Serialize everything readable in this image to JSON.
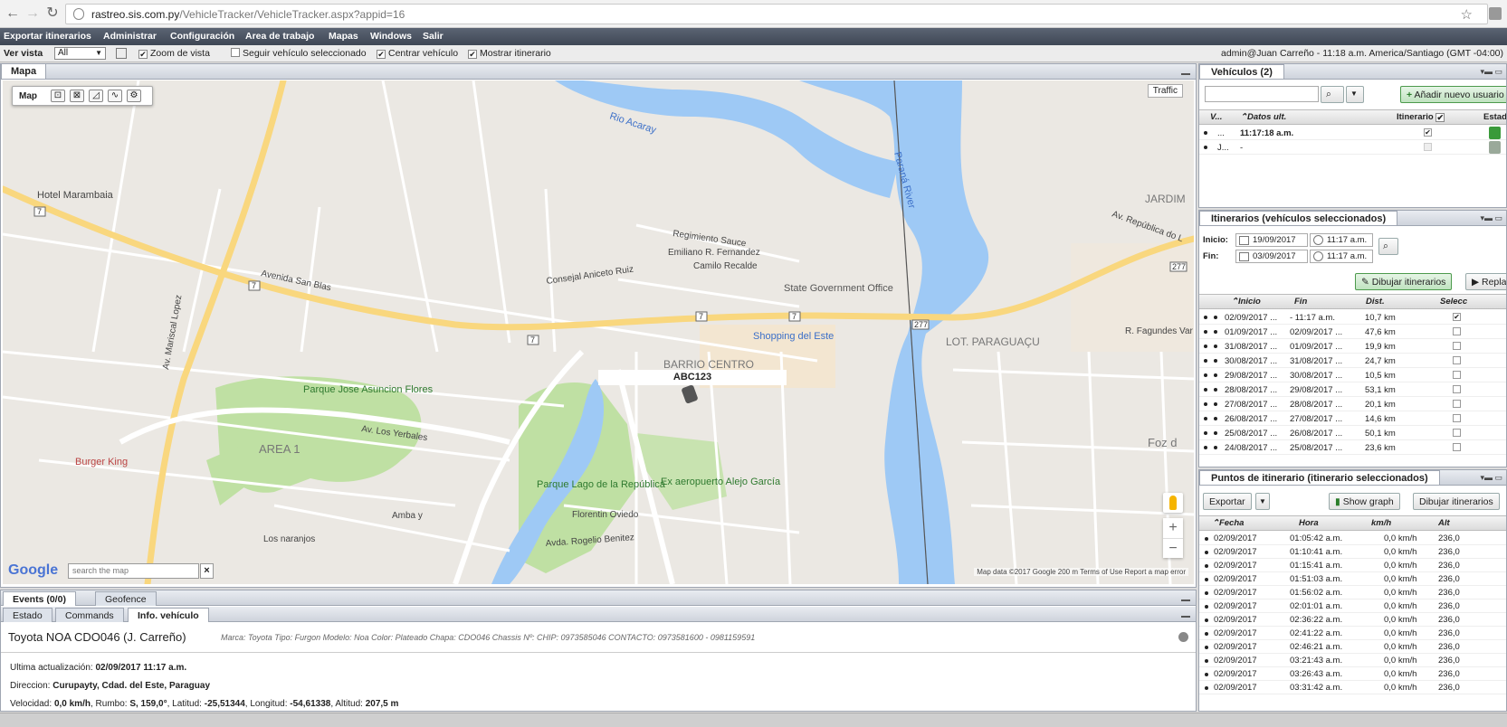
{
  "browser": {
    "url_host": "rastreo.sis.com.py",
    "url_path": "/VehicleTracker/VehicleTracker.aspx?appid=16"
  },
  "menu": [
    "Exportar itinerarios",
    "Administrar",
    "Configuración",
    "Area de trabajo",
    "Mapas",
    "Windows",
    "Salir"
  ],
  "toolbar": {
    "ver_vista_label": "Ver vista",
    "ver_vista_value": "All",
    "zoom_de_vista": "Zoom de vista",
    "seguir_vehiculo": "Seguir vehículo seleccionado",
    "centrar_vehiculo": "Centrar vehículo",
    "mostrar_itinerario": "Mostrar itinerario",
    "user_info": "admin@Juan Carreño - 11:18 a.m. America/Santiago (GMT -04:00)"
  },
  "map_panel": {
    "title": "Mapa",
    "map_label": "Map",
    "traffic": "Traffic",
    "vehicle_label": "ABC123",
    "search_placeholder": "search the map",
    "close": "×",
    "google": "Google",
    "attribution": "Map data ©2017 Google    200 m          Terms of Use    Report a map error",
    "zoom_in": "+",
    "zoom_out": "−",
    "places": {
      "hotel": "Hotel Marambaia",
      "state_gov": "State Government Office",
      "shopping": "Shopping del Este",
      "barrio": "BARRIO CENTRO",
      "parque_jose": "Parque Jose Asuncion Flores",
      "area1": "AREA 1",
      "burger": "Burger King",
      "lago": "Lago de la Republica",
      "parque_lago": "Parque Lago de la República",
      "aeropuerto": "Ex aeropuerto Alejo García",
      "rio_acaray": "Rio Acaray",
      "parana": "Paraná River",
      "lot_paraguacu": "LOT. PARAGUAÇU",
      "jardim": "JARDIM",
      "foz": "Foz d",
      "av_san_blas": "Avenida San Blas",
      "av_mariscal": "Av. Mariscal Lopez",
      "av_mariscal_2": "Av. Mariscal López",
      "florentin": "Florentin Oviedo",
      "rogelio": "Avda. Rogelio Benitez",
      "amba": "Amba y",
      "naranjos": "Los naranjos",
      "av_los_yerbales": "Av. Los Yerbales",
      "emiliano": "Emiliano R. Fernandez",
      "camilo": "Camilo Recalde",
      "consejal": "Consejal Aniceto Ruiz",
      "regimiento": "Regimiento Sauce",
      "av_republica": "Av. República do L",
      "av_fagundes": "R. Fagundes Var"
    }
  },
  "info_panel": {
    "events_tab": "Events (0/0)",
    "geofence_tab": "Geofence",
    "tabs": [
      "Estado",
      "Commands",
      "Info. vehículo"
    ],
    "vehicle_title": "Toyota NOA CDO046 (J. Carreño)",
    "vehicle_meta": "Marca: Toyota Tipo: Furgon Modelo: Noa Color: Plateado Chapa: CDO046 Chassis Nº: CHIP: 0973585046 CONTACTO: 0973581600 - 0981159591",
    "ultima_label": "Ultima actualización:",
    "ultima_value": "02/09/2017 11:17 a.m.",
    "direccion_label": "Direccion:",
    "direccion_value": "Curupayty, Cdad. del Este, Paraguay",
    "velocidad_label": "Velocidad:",
    "velocidad_value": "0,0 km/h",
    "rumbo_label": "Rumbo:",
    "rumbo_value": "S, 159,0°",
    "latitud_label": "Latitud:",
    "latitud_value": "-25,51344",
    "longitud_label": "Longitud:",
    "longitud_value": "-54,61338",
    "altitud_label": "Altitud:",
    "altitud_value": "207,5 m"
  },
  "vehicles_panel": {
    "title": "Vehículos (2)",
    "add_user": "Añadir nuevo usuario",
    "col_v": "V...",
    "col_datos": "Datos ult.",
    "col_itinerario": "Itinerario",
    "col_estado": "Estad",
    "rows": [
      {
        "v": "...",
        "datos": "11:17:18 a.m.",
        "itin": "✔",
        "status_color": "#3a9a3a"
      },
      {
        "v": "J...",
        "datos": "-",
        "itin": "",
        "status_color": "#9aa99a"
      }
    ]
  },
  "itinerarios_panel": {
    "title": "Itinerarios (vehículos seleccionados)",
    "inicio_label": "Inicio:",
    "fin_label": "Fin:",
    "inicio_date": "19/09/2017",
    "inicio_time": "11:17 a.m.",
    "fin_date": "03/09/2017",
    "fin_time": "11:17 a.m.",
    "dibujar": "Dibujar itinerarios",
    "replay": "Repla",
    "cols": [
      "Inicio",
      "Fin",
      "Dist.",
      "Selecc"
    ],
    "rows": [
      {
        "inicio": "02/09/2017 ...",
        "fin": "- 11:17 a.m.",
        "dist": "10,7 km",
        "sel": "✔"
      },
      {
        "inicio": "01/09/2017 ...",
        "fin": "02/09/2017 ...",
        "dist": "47,6 km",
        "sel": ""
      },
      {
        "inicio": "31/08/2017 ...",
        "fin": "01/09/2017 ...",
        "dist": "19,9 km",
        "sel": ""
      },
      {
        "inicio": "30/08/2017 ...",
        "fin": "31/08/2017 ...",
        "dist": "24,7 km",
        "sel": ""
      },
      {
        "inicio": "29/08/2017 ...",
        "fin": "30/08/2017 ...",
        "dist": "10,5 km",
        "sel": ""
      },
      {
        "inicio": "28/08/2017 ...",
        "fin": "29/08/2017 ...",
        "dist": "53,1 km",
        "sel": ""
      },
      {
        "inicio": "27/08/2017 ...",
        "fin": "28/08/2017 ...",
        "dist": "20,1 km",
        "sel": ""
      },
      {
        "inicio": "26/08/2017 ...",
        "fin": "27/08/2017 ...",
        "dist": "14,6 km",
        "sel": ""
      },
      {
        "inicio": "25/08/2017 ...",
        "fin": "26/08/2017 ...",
        "dist": "50,1 km",
        "sel": ""
      },
      {
        "inicio": "24/08/2017 ...",
        "fin": "25/08/2017 ...",
        "dist": "23,6 km",
        "sel": ""
      }
    ]
  },
  "puntos_panel": {
    "title": "Puntos de itinerario (itinerario seleccionados)",
    "exportar": "Exportar",
    "show_graph": "Show graph",
    "dibujar": "Dibujar itinerarios",
    "cols": [
      "Fecha",
      "Hora",
      "km/h",
      "Alt"
    ],
    "rows": [
      {
        "fecha": "02/09/2017",
        "hora": "01:05:42 a.m.",
        "kmh": "0,0 km/h",
        "alt": "236,0"
      },
      {
        "fecha": "02/09/2017",
        "hora": "01:10:41 a.m.",
        "kmh": "0,0 km/h",
        "alt": "236,0"
      },
      {
        "fecha": "02/09/2017",
        "hora": "01:15:41 a.m.",
        "kmh": "0,0 km/h",
        "alt": "236,0"
      },
      {
        "fecha": "02/09/2017",
        "hora": "01:51:03 a.m.",
        "kmh": "0,0 km/h",
        "alt": "236,0"
      },
      {
        "fecha": "02/09/2017",
        "hora": "01:56:02 a.m.",
        "kmh": "0,0 km/h",
        "alt": "236,0"
      },
      {
        "fecha": "02/09/2017",
        "hora": "02:01:01 a.m.",
        "kmh": "0,0 km/h",
        "alt": "236,0"
      },
      {
        "fecha": "02/09/2017",
        "hora": "02:36:22 a.m.",
        "kmh": "0,0 km/h",
        "alt": "236,0"
      },
      {
        "fecha": "02/09/2017",
        "hora": "02:41:22 a.m.",
        "kmh": "0,0 km/h",
        "alt": "236,0"
      },
      {
        "fecha": "02/09/2017",
        "hora": "02:46:21 a.m.",
        "kmh": "0,0 km/h",
        "alt": "236,0"
      },
      {
        "fecha": "02/09/2017",
        "hora": "03:21:43 a.m.",
        "kmh": "0,0 km/h",
        "alt": "236,0"
      },
      {
        "fecha": "02/09/2017",
        "hora": "03:26:43 a.m.",
        "kmh": "0,0 km/h",
        "alt": "236,0"
      },
      {
        "fecha": "02/09/2017",
        "hora": "03:31:42 a.m.",
        "kmh": "0,0 km/h",
        "alt": "236,0"
      }
    ]
  }
}
